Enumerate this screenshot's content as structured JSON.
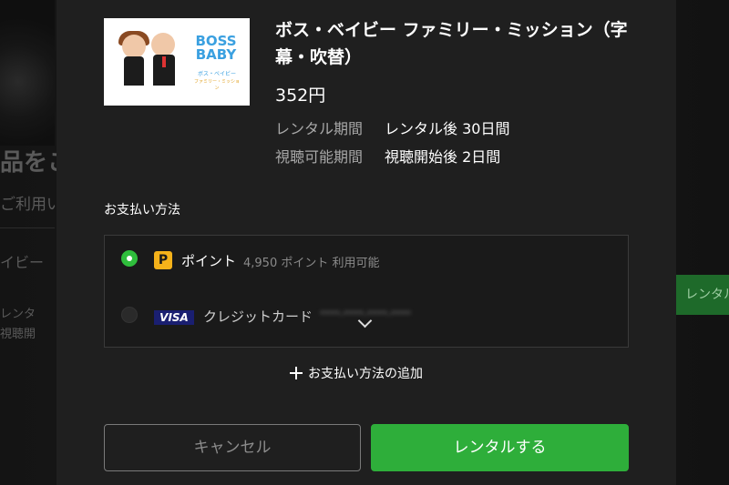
{
  "background": {
    "heading_fragment": "品をこ",
    "line_fragment": "ご利用い",
    "title_fragment": "イビー",
    "meta_label_fragment": "レンタ",
    "meta_label_fragment_2": "視聴開",
    "right_button_fragment": "レンタル"
  },
  "modal": {
    "title": "ボス・ベイビー ファミリー・ミッション（字幕・吹替）",
    "thumbnail": {
      "logo_text": "BOSS BABY",
      "logo_sub": "ボス・ベイビー",
      "logo_sub2": "ファミリー・ミッション"
    },
    "price": "352円",
    "meta": [
      {
        "label": "レンタル期間",
        "value": "レンタル後 30日間"
      },
      {
        "label": "視聴可能期間",
        "value": "視聴開始後 2日間"
      }
    ],
    "payment": {
      "heading": "お支払い方法",
      "options": [
        {
          "icon": "points-icon",
          "icon_text": "P",
          "label": "ポイント",
          "detail": "4,950 ポイント 利用可能",
          "selected": true
        },
        {
          "icon": "visa-card-icon",
          "icon_text": "VISA",
          "label": "クレジットカード",
          "detail": "****-****-****-****",
          "selected": false
        }
      ],
      "add_label": "お支払い方法の追加"
    },
    "buttons": {
      "cancel": "キャンセル",
      "rent": "レンタルする"
    }
  },
  "colors": {
    "accent_green": "#2eae3a",
    "points_yellow": "#f5b21a",
    "visa_blue": "#1a1f71",
    "modal_bg": "#1f1f1f"
  }
}
